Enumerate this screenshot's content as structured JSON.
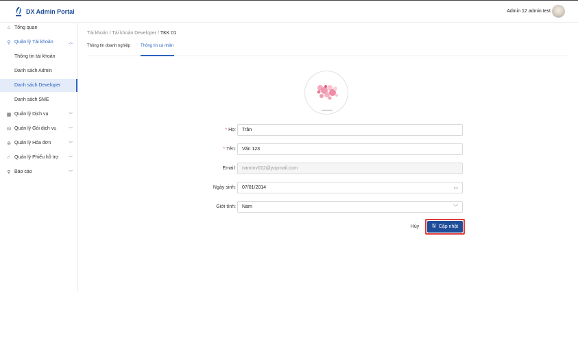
{
  "header": {
    "brand": "DX Admin Portal",
    "user_name": "Admin 12 admin test"
  },
  "sidebar": {
    "items": [
      {
        "label": "Tổng quan",
        "icon": "home-icon"
      },
      {
        "label": "Quản lý Tài khoản",
        "icon": "user-icon",
        "expanded": true
      },
      {
        "label": "Thông tin tài khoản"
      },
      {
        "label": "Danh sách Admin"
      },
      {
        "label": "Danh sách Developer",
        "selected": true
      },
      {
        "label": "Danh sách SME"
      },
      {
        "label": "Quản lý Dịch vụ",
        "icon": "grid-icon"
      },
      {
        "label": "Quản lý Gói dịch vụ",
        "icon": "package-icon"
      },
      {
        "label": "Quản lý Hóa đơn",
        "icon": "invoice-icon"
      },
      {
        "label": "Quản lý Phiếu hỗ trợ",
        "icon": "headset-icon"
      },
      {
        "label": "Báo cáo",
        "icon": "report-icon"
      }
    ]
  },
  "breadcrumb": {
    "part1": "Tài khoản",
    "sep": "/",
    "part2": "Tài khoản Developer",
    "current": "TKK 01"
  },
  "tabs": {
    "tab1": "Thông tin doanh nghiệp",
    "tab2": "Thông tin cá nhân"
  },
  "form": {
    "ho_label": "Họ",
    "ho_value": "Trần",
    "ten_label": "Tên",
    "ten_value": "Văn 123",
    "email_label": "Email",
    "email_value": "nammv012@yopmail.com",
    "dob_label": "Ngày sinh",
    "dob_value": "07/01/2014",
    "gender_label": "Giới tính",
    "gender_value": "Nam",
    "required_mark": "*",
    "colon": ":"
  },
  "actions": {
    "cancel": "Hủy",
    "update": "Cập nhật"
  },
  "colors": {
    "brand": "#1d4b95",
    "accent": "#2b63c2",
    "primary_button": "#1f4e99",
    "highlight_outline": "#e03b3b",
    "required": "#e5484d"
  }
}
